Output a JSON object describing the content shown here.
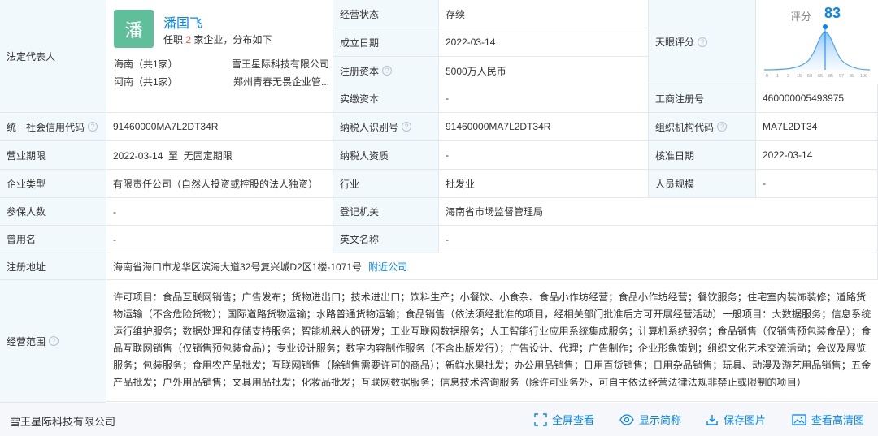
{
  "legal_rep": {
    "label": "法定代表人",
    "avatar_char": "潘",
    "name": "潘国飞",
    "jobs_prefix": "任职",
    "jobs_count": "2",
    "jobs_suffix": "家企业，分布如下",
    "regions": [
      {
        "region": "海南（共1家）",
        "company": "雪王星际科技有限公司"
      },
      {
        "region": "河南（共1家）",
        "company": "郑州青春无畏企业管..."
      }
    ]
  },
  "rows": {
    "status_label": "经营状态",
    "status_value": "存续",
    "founded_label": "成立日期",
    "founded_value": "2022-03-14",
    "capital_label": "注册资本",
    "capital_value": "5000万人民币",
    "paid_label": "实缴资本",
    "paid_value": "-",
    "score_label": "天眼评分",
    "regno_label": "工商注册号",
    "regno_value": "460000005493975",
    "credit_label": "统一社会信用代码",
    "credit_value": "91460000MA7L2DT34R",
    "taxid_label": "纳税人识别号",
    "taxid_value": "91460000MA7L2DT34R",
    "org_label": "组织机构代码",
    "org_value": "MA7L2DT34",
    "term_label": "营业期限",
    "term_value": "2022-03-14  至  无固定期限",
    "taxq_label": "纳税人资质",
    "taxq_value": "-",
    "approve_label": "核准日期",
    "approve_value": "2022-03-14",
    "type_label": "企业类型",
    "type_value": "有限责任公司（自然人投资或控股的法人独资）",
    "industry_label": "行业",
    "industry_value": "批发业",
    "staff_label": "人员规模",
    "staff_value": "-",
    "insured_label": "参保人数",
    "insured_value": "-",
    "regauth_label": "登记机关",
    "regauth_value": "海南省市场监督管理局",
    "former_label": "曾用名",
    "former_value": "-",
    "english_label": "英文名称",
    "english_value": "-",
    "address_label": "注册地址",
    "address_value": "海南省海口市龙华区滨海大道32号复兴城D2区1楼-1071号",
    "address_link": "附近公司",
    "scope_label": "经营范围",
    "scope_value": "许可项目：食品互联网销售；广告发布；货物进出口；技术进出口；饮料生产；小餐饮、小食杂、食品小作坊经营；食品小作坊经营；餐饮服务；住宅室内装饰装修；道路货物运输（不含危险货物）；国际道路货物运输；水路普通货物运输；食品销售（依法须经批准的项目，经相关部门批准后方可开展经营活动）一般项目：大数据服务；信息系统运行维护服务；数据处理和存储支持服务；智能机器人的研发；工业互联网数据服务；人工智能行业应用系统集成服务；计算机系统服务；食品销售（仅销售预包装食品）；食品互联网销售（仅销售预包装食品）；专业设计服务；数字内容制作服务（不含出版发行）；广告设计、代理；广告制作；企业形象策划；组织文化艺术交流活动；会议及展览服务；包装服务；食用农产品批发；互联网销售（除销售需要许可的商品）；新鲜水果批发；办公用品销售；日用百货销售；日用杂品销售；玩具、动漫及游艺用品销售；五金产品批发；户外用品销售；文具用品批发；化妆品批发；互联网数据服务；信息技术咨询服务（除许可业务外，可自主依法经营法律法规非禁止或限制的项目）"
  },
  "score": {
    "label": "评分",
    "value": "83",
    "ticks": [
      "0",
      "1",
      "3",
      "15",
      "50",
      "65",
      "85",
      "97",
      "99",
      "100"
    ],
    "accent": "#0084ff"
  },
  "footer": {
    "company": "雪王星际科技有限公司",
    "fullscreen": "全屏查看",
    "brief": "显示简称",
    "save": "保存图片",
    "hd": "查看高清图"
  }
}
